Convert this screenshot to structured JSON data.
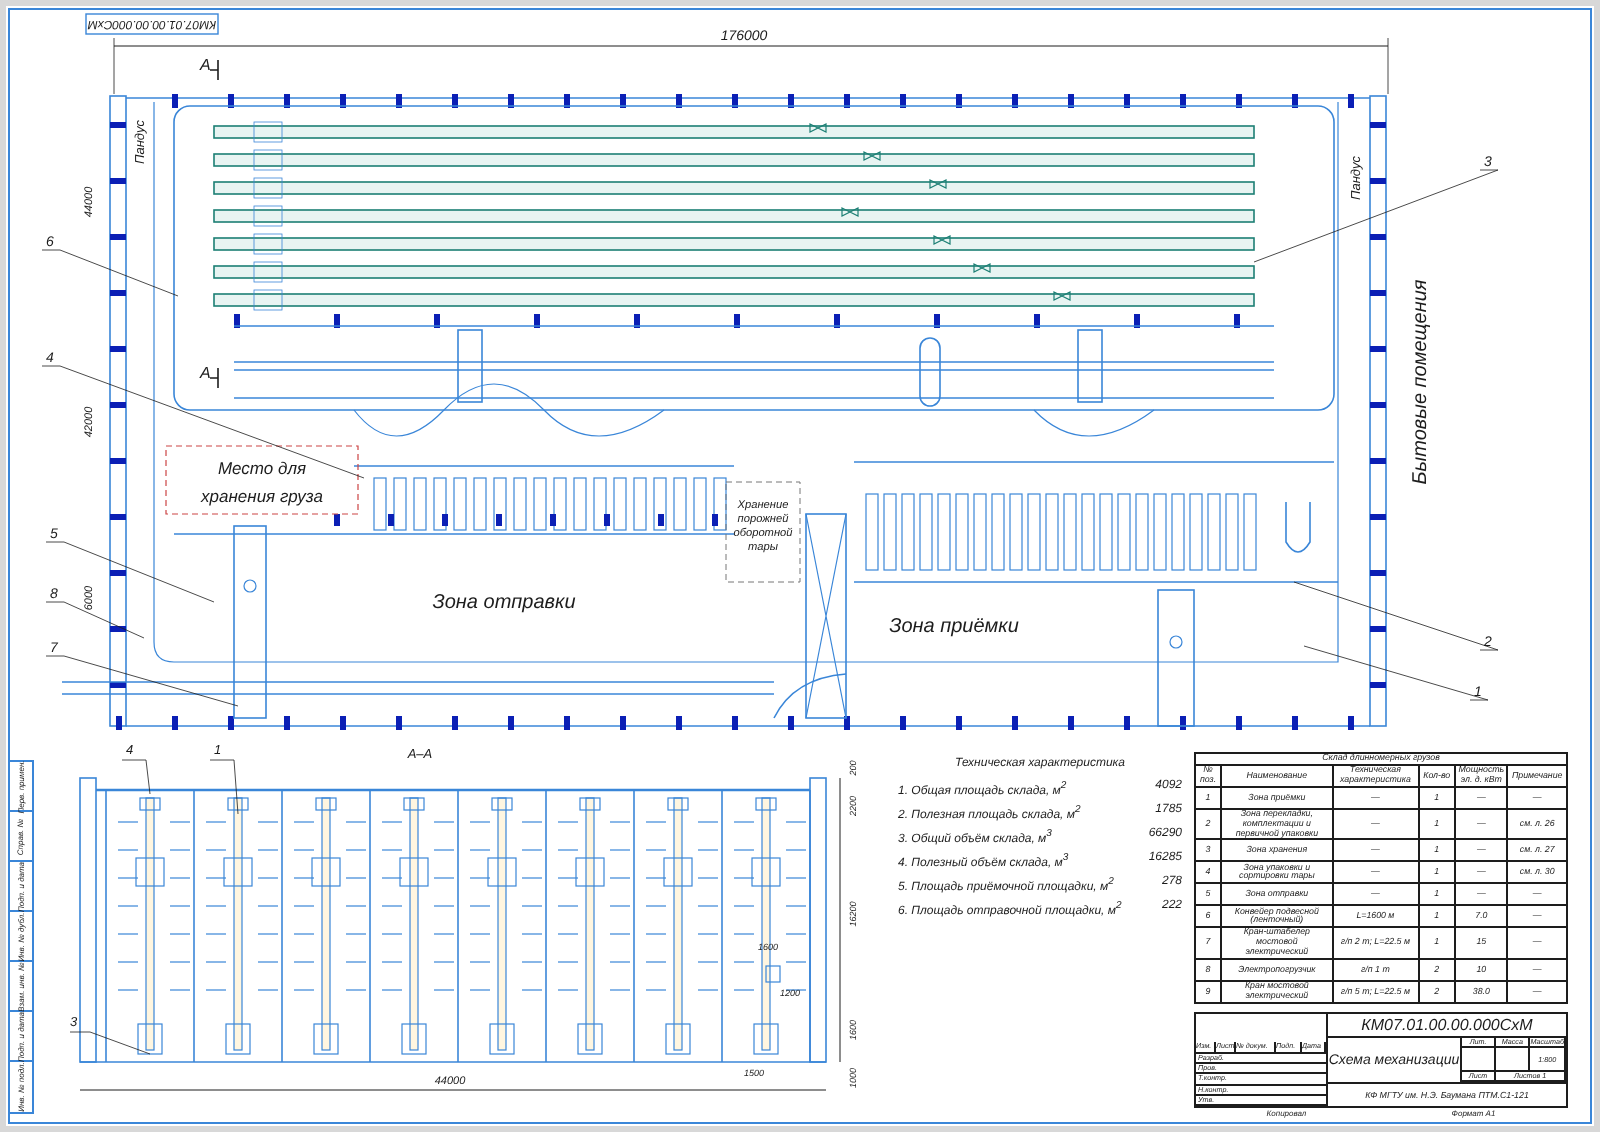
{
  "sheet": {
    "stamp_code": "КМ07.01.00.00.000СхМ",
    "side_stamps": [
      "Перв. примен.",
      "Справ. №",
      "Подп. и дата",
      "Инв. № дубл.",
      "Взам. инв. №",
      "Подп. и дата",
      "Инв. № подл."
    ]
  },
  "plan": {
    "overall_dimension": "176000",
    "side_dimensions": [
      "44000",
      "42000",
      "6000"
    ],
    "section_marks": [
      "А",
      "А"
    ],
    "ramp_labels": [
      "Пандус",
      "Пандус"
    ],
    "amenity_label": "Бытовые помещения",
    "cargo_storage_label": [
      "Место для",
      "хранения груза"
    ],
    "tare_storage_label": [
      "Хранение",
      "порожней",
      "оборотной",
      "тары"
    ],
    "zones": [
      "Зона отправки",
      "Зона приёмки"
    ],
    "callouts": [
      "6",
      "4",
      "5",
      "8",
      "7",
      "3",
      "2",
      "1"
    ]
  },
  "section": {
    "title": "А–А",
    "width_dimension": "44000",
    "height_dimensions": [
      "200",
      "2200",
      "16200",
      "1600",
      "1000"
    ],
    "detail_dimensions": [
      "1600",
      "1200",
      "1500"
    ],
    "callouts": [
      "4",
      "1",
      "3"
    ]
  },
  "tech": {
    "title": "Техническая характеристика",
    "items": [
      {
        "name": "1. Общая площадь склада, м$^{2}$",
        "value": "4092"
      },
      {
        "name": "2. Полезная площадь склада, м$^{2}$",
        "value": "1785"
      },
      {
        "name": "3. Общий объём склада, м$^{3}$",
        "value": "66290"
      },
      {
        "name": "4. Полезный объём склада, м$^{3}$",
        "value": "16285"
      },
      {
        "name": "5. Площадь приёмочной площадки, м$^{2}$",
        "value": "278"
      },
      {
        "name": "6. Площадь отправочной площадки, м$^{2}$",
        "value": "222"
      }
    ]
  },
  "spec": {
    "title": "Склад длинномерных грузов",
    "columns": [
      "№ поз.",
      "Наименование",
      "Техническая характеристика",
      "Кол-во",
      "Мощность эл. д. кВт",
      "Примечание"
    ],
    "rows": [
      [
        "1",
        "Зона приёмки",
        "—",
        "1",
        "—",
        "—"
      ],
      [
        "2",
        "Зона перекладки, комплектации и первичной упаковки",
        "—",
        "1",
        "—",
        "см. л. 26"
      ],
      [
        "3",
        "Зона хранения",
        "—",
        "1",
        "—",
        "см. л. 27"
      ],
      [
        "4",
        "Зона упаковки и сортировки тары",
        "—",
        "1",
        "—",
        "см. л. 30"
      ],
      [
        "5",
        "Зона отправки",
        "—",
        "1",
        "—",
        "—"
      ],
      [
        "6",
        "Конвейер подвесной (ленточный)",
        "L=1600 м",
        "1",
        "7.0",
        "—"
      ],
      [
        "7",
        "Кран-штабелер мостовой электрический",
        "г/п 2 т; L=22.5 м",
        "1",
        "15",
        "—"
      ],
      [
        "8",
        "Электропогрузчик",
        "г/п 1 т",
        "2",
        "10",
        "—"
      ],
      [
        "9",
        "Кран мостовой электрический",
        "г/п 5 т; L=22.5 м",
        "2",
        "38.0",
        "—"
      ]
    ]
  },
  "title_block": {
    "code": "КМ07.01.00.00.000СхМ",
    "title": "Схема механизации",
    "change_headers": [
      "Изм.",
      "Лист",
      "№ докум.",
      "Подп.",
      "Дата"
    ],
    "roles": [
      "Разраб.",
      "Пров.",
      "Т.контр.",
      "Н.контр.",
      "Утв."
    ],
    "info_headers": [
      "Лит.",
      "Масса",
      "Масштаб"
    ],
    "scale": "1:800",
    "sheet": "Лист",
    "sheets": "Листов 1",
    "organization": "КФ МГТУ им. Н.Э. Баумана ПТМ.С1-121",
    "copied": "Копировал",
    "format": "Формат А1"
  }
}
